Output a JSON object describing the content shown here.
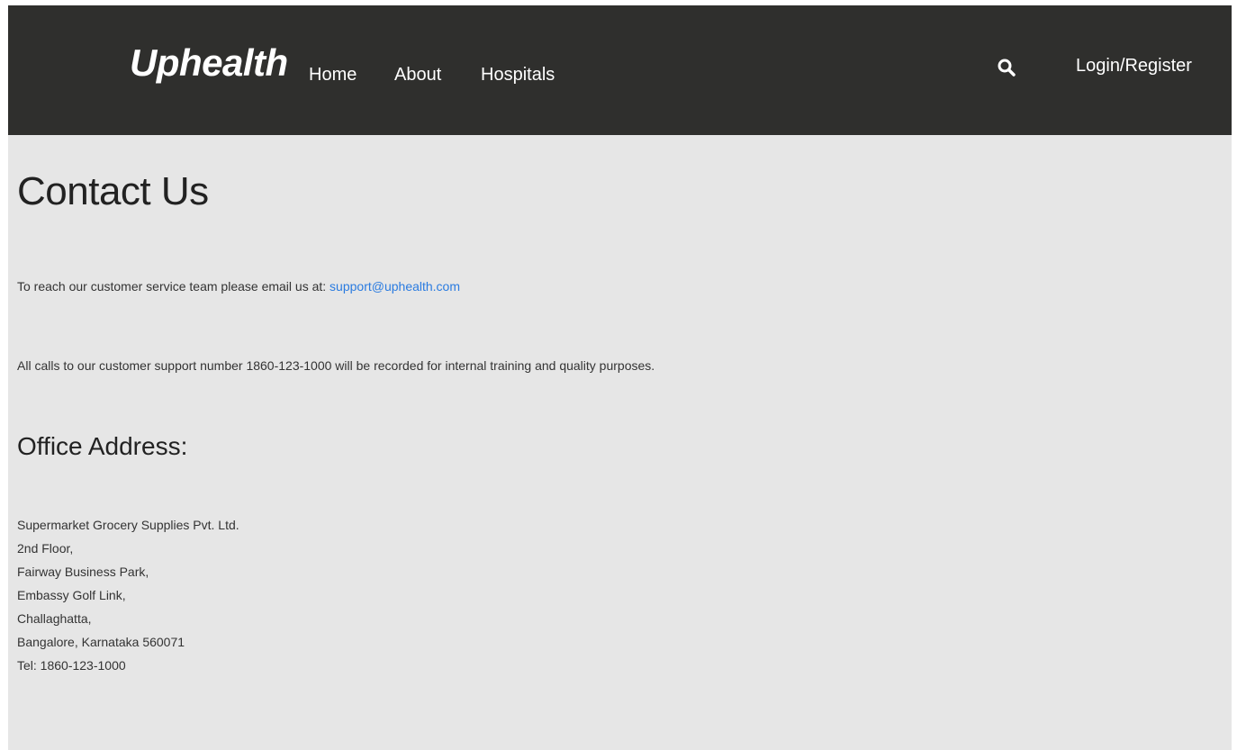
{
  "navbar": {
    "brand": "Uphealth",
    "links": [
      {
        "label": "Home"
      },
      {
        "label": "About"
      },
      {
        "label": "Hospitals"
      }
    ],
    "search_icon": "search-icon",
    "login_label": "Login/Register"
  },
  "main": {
    "title": "Contact Us",
    "email_text": "To reach our customer service team please email us at: ",
    "email": "support@uphealth.com",
    "calls_text": "All calls to our customer support number 1860-123-1000 will be recorded for internal training and quality purposes.",
    "office_title": "Office Address:",
    "address_lines": [
      "Supermarket Grocery Supplies Pvt. Ltd.",
      "2nd Floor,",
      "Fairway Business Park,",
      "Embassy Golf Link,",
      "Challaghatta,",
      "Bangalore, Karnataka 560071",
      "Tel: 1860-123-1000"
    ]
  },
  "colors": {
    "navbar_bg": "#2f2f2d",
    "page_bg": "#e6e6e6",
    "link": "#2a7be0"
  }
}
